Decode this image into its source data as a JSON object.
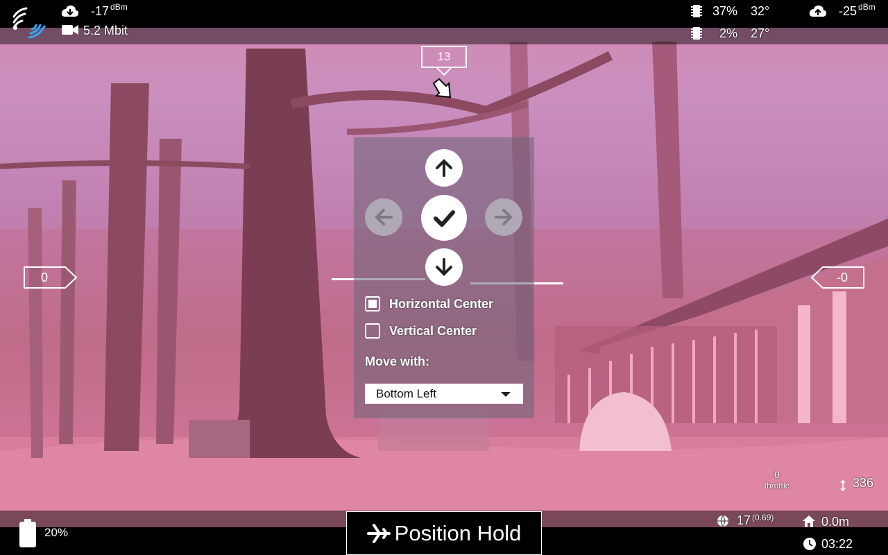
{
  "status_top_left": {
    "rssi": "-17",
    "rssi_unit": "dBm",
    "video_bitrate": "5.2 Mbit"
  },
  "status_top_right": {
    "cpu1_load": "37%",
    "cpu1_temp": "32°",
    "cpu2_load": "2%",
    "cpu2_temp": "27°",
    "uplink_rssi": "-25",
    "uplink_unit": "dBm"
  },
  "hud": {
    "heading": "13",
    "speed_ladder_left": "0",
    "alt_ladder_right": "-0"
  },
  "panel": {
    "horizontal_center_label": "Horizontal Center",
    "horizontal_center_checked": true,
    "vertical_center_label": "Vertical Center",
    "vertical_center_checked": false,
    "move_with_label": "Move with:",
    "move_with_value": "Bottom Left"
  },
  "bottom": {
    "battery_percent": "20%",
    "flight_mode": "Position Hold",
    "satellites": "17",
    "hdop": "(0.69)",
    "home_distance": "0.0m",
    "flight_time": "03:22",
    "throttle_value": "0",
    "throttle_label": "throttle",
    "altitude_value": "336"
  },
  "colors": {
    "wifi_accent": "#2ea8ff",
    "panel_bg": "rgba(110,100,120,0.55)",
    "button_active": "#ffffff",
    "button_inactive": "#b0a8b4"
  }
}
